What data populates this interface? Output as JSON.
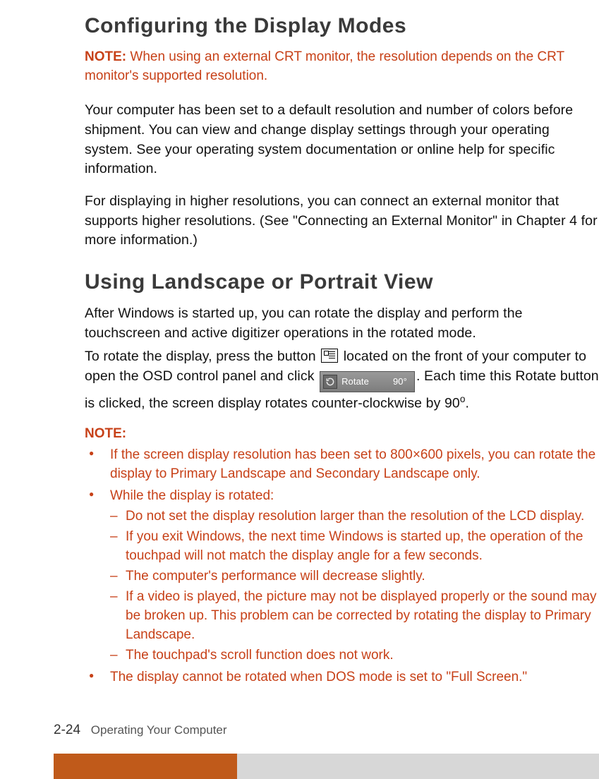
{
  "heading1": "Configuring the Display Modes",
  "note1": {
    "label": "NOTE:",
    "text": " When using an external CRT monitor, the resolution depends on the CRT monitor's supported resolution."
  },
  "para1": "Your computer has been set to a default resolution and number of colors before shipment. You can view and change display settings through your operating system. See your operating system documentation or online help for specific information.",
  "para2": "For displaying in higher resolutions, you can connect an external monitor that supports higher resolutions. (See \"Connecting an External Monitor\" in Chapter 4 for more information.)",
  "heading2": "Using Landscape or Portrait View",
  "para3": "After Windows is started up, you can rotate the display and perform the touchscreen and active digitizer operations in the rotated mode.",
  "rotate": {
    "pre": "To rotate the display, press the button ",
    "mid": " located on the front of your computer to open the OSD control panel and click ",
    "btn_text": "Rotate",
    "btn_deg": "90°",
    "post1": ". Each time this Rotate button is clicked, the screen display rotates counter-clockwise by 90",
    "post2": "."
  },
  "noteBlockLabel": "NOTE:",
  "bullets": {
    "b1": "If the screen display resolution has been set to 800×600 pixels, you can rotate the display to Primary Landscape and Secondary Landscape only.",
    "b2": "While the display is rotated:",
    "b2s": {
      "s1": "Do not set the display resolution larger than the resolution of the LCD display.",
      "s2": "If you exit Windows, the next time Windows is started up, the operation of the touchpad will not match the display angle for a few seconds.",
      "s3": "The computer's performance will decrease slightly.",
      "s4": "If a video is played, the picture may not be displayed properly or the sound may be broken up. This problem can be corrected by rotating the display to Primary Landscape.",
      "s5": "The touchpad's scroll function does not work."
    },
    "b3": "The display cannot be rotated when DOS mode is set to \"Full Screen.\""
  },
  "footer": {
    "pageNum": "2-24",
    "chapter": "Operating Your Computer"
  }
}
